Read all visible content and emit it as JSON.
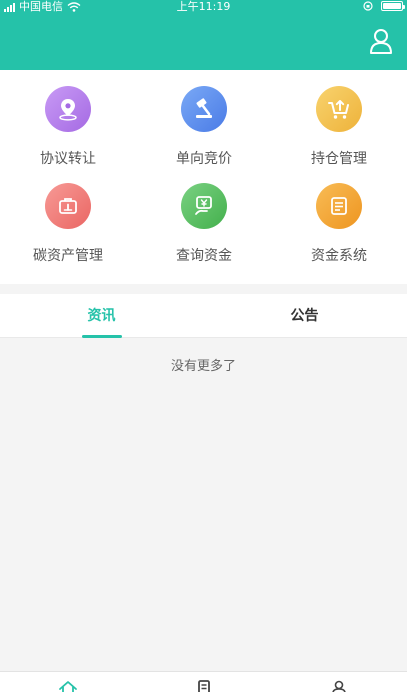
{
  "status_bar": {
    "carrier": "中国电信",
    "time": "上午11:19"
  },
  "header": {
    "background_color": "#25c2a9",
    "user_icon": "user-icon"
  },
  "menu": {
    "items": [
      {
        "label": "协议转让",
        "icon": "location-pin-icon",
        "color": "#b07ee8"
      },
      {
        "label": "单向竞价",
        "icon": "auction-hammer-icon",
        "color": "#5c8ff0"
      },
      {
        "label": "持仓管理",
        "icon": "cart-upload-icon",
        "color": "#f2c046"
      },
      {
        "label": "碳资产管理",
        "icon": "briefcase-icon",
        "color": "#f07a78"
      },
      {
        "label": "查询资金",
        "icon": "money-hand-icon",
        "color": "#55c25f"
      },
      {
        "label": "资金系统",
        "icon": "ledger-icon",
        "color": "#f2a52c"
      }
    ]
  },
  "tabs": [
    {
      "label": "资讯",
      "active": true
    },
    {
      "label": "公告",
      "active": false
    }
  ],
  "content": {
    "empty_message": "没有更多了"
  },
  "bottom_nav": {
    "items": [
      {
        "icon": "home-icon",
        "active": true
      },
      {
        "icon": "document-icon",
        "active": false
      },
      {
        "icon": "profile-icon",
        "active": false
      }
    ]
  },
  "colors": {
    "accent": "#25c2a9",
    "page_background": "#f4f4f4"
  }
}
